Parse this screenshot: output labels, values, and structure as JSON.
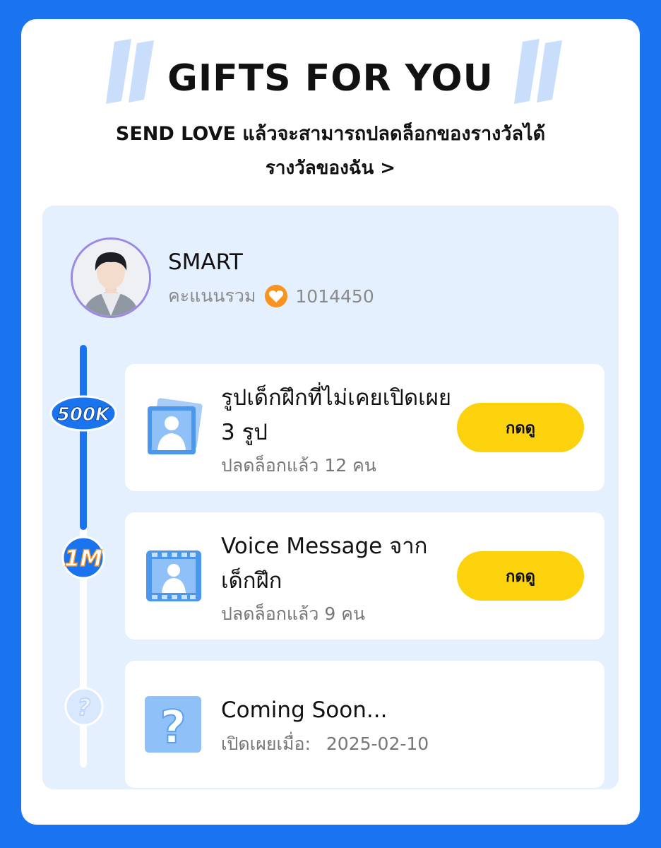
{
  "header": {
    "title": "GIFTS FOR YOU",
    "subtitle": "SEND LOVE แล้วจะสามารถปลดล็อกของรางวัลได้",
    "my_rewards_link": "รางวัลของฉัน >"
  },
  "profile": {
    "name": "SMART",
    "score_label": "คะแนนรวม",
    "score_value": "1014450"
  },
  "milestones": [
    {
      "badge": "500K",
      "reached": true
    },
    {
      "badge": "1M",
      "reached": true
    },
    {
      "badge": "?",
      "reached": false
    }
  ],
  "rewards": [
    {
      "title": "รูปเด็กฝึกที่ไม่เคยเปิดเผย 3 รูป",
      "subtitle": "ปลดล็อกแล้ว 12 คน",
      "button": "กดดู",
      "icon": "photo-icon"
    },
    {
      "title": "Voice Message จาก เด็กฝึก",
      "subtitle": "ปลดล็อกแล้ว 9 คน",
      "button": "กดดู",
      "icon": "video-icon"
    },
    {
      "title": "Coming Soon...",
      "subtitle_label": "เปิดเผยเมื่อ:",
      "subtitle_value": "2025-02-10",
      "icon": "question-icon"
    }
  ],
  "colors": {
    "background": "#1a74f0",
    "panel": "#e4f0fe",
    "button": "#fcd20c",
    "accent": "#1a74f0",
    "heart": "#f7931e"
  }
}
